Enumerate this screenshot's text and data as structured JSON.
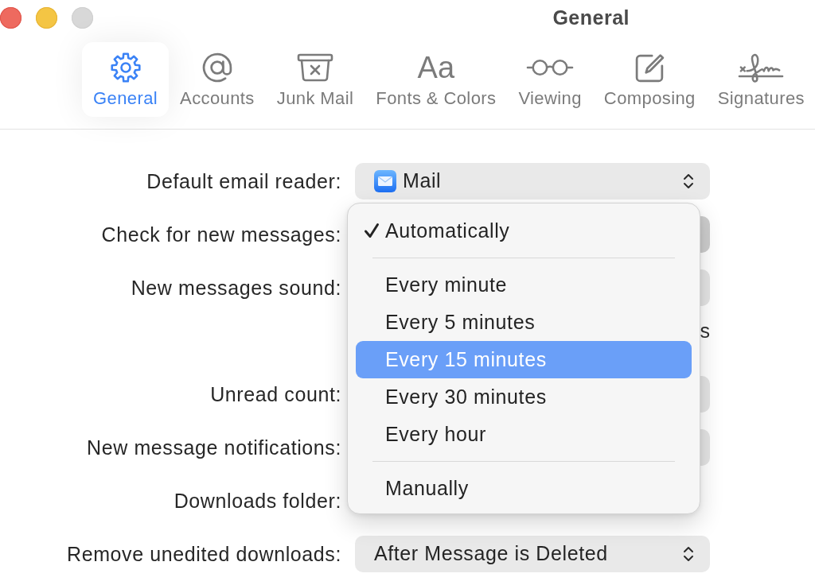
{
  "window": {
    "title": "General"
  },
  "window_controls": [
    {
      "kind": "close",
      "disabled": false
    },
    {
      "kind": "minimize",
      "disabled": false
    },
    {
      "kind": "zoom",
      "disabled": true
    }
  ],
  "toolbar": {
    "tabs": [
      {
        "label": "General",
        "selected": true
      },
      {
        "label": "Accounts",
        "selected": false
      },
      {
        "label": "Junk Mail",
        "selected": false
      },
      {
        "label": "Fonts & Colors",
        "selected": false,
        "icon_text": "Aa"
      },
      {
        "label": "Viewing",
        "selected": false
      },
      {
        "label": "Composing",
        "selected": false
      },
      {
        "label": "Signatures",
        "selected": false
      }
    ]
  },
  "form": {
    "rows": [
      {
        "kind": "popup",
        "label": "Default email reader:",
        "value": "Mail",
        "app_icon": true
      },
      {
        "kind": "covered_popup",
        "label": "Check for new messages:",
        "open": true,
        "menu": {
          "groups": [
            {
              "items": [
                {
                  "label": "Automatically",
                  "checked": true,
                  "selected": false
                }
              ]
            },
            {
              "items": [
                {
                  "label": "Every minute",
                  "checked": false,
                  "selected": false
                },
                {
                  "label": "Every 5 minutes",
                  "checked": false,
                  "selected": false
                },
                {
                  "label": "Every 15 minutes",
                  "checked": false,
                  "selected": true
                },
                {
                  "label": "Every 30 minutes",
                  "checked": false,
                  "selected": false
                },
                {
                  "label": "Every hour",
                  "checked": false,
                  "selected": false
                }
              ]
            },
            {
              "items": [
                {
                  "label": "Manually",
                  "checked": false,
                  "selected": false
                }
              ]
            }
          ]
        }
      },
      {
        "kind": "covered_popup",
        "label": "New messages sound:",
        "open": false
      },
      {
        "kind": "covered_text",
        "text": "s"
      },
      {
        "kind": "covered_popup",
        "label": "Unread count:",
        "open": false
      },
      {
        "kind": "covered_popup",
        "label": "New message notifications:",
        "open": false
      },
      {
        "kind": "label_only",
        "label": "Downloads folder:"
      },
      {
        "kind": "popup",
        "label": "Remove unedited downloads:",
        "value": "After Message is Deleted"
      }
    ]
  }
}
